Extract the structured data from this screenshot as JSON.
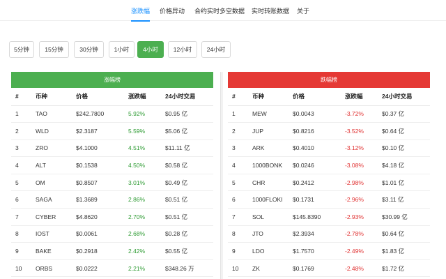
{
  "nav": {
    "tabs": [
      {
        "label": "涨跌幅",
        "active": true
      },
      {
        "label": "价格异动",
        "active": false
      },
      {
        "label": "合约实时多空数据",
        "active": false
      },
      {
        "label": "实时转账数据",
        "active": false
      },
      {
        "label": "关于",
        "active": false
      }
    ]
  },
  "timeframes": [
    {
      "label": "5分钟",
      "active": false
    },
    {
      "label": "15分钟",
      "active": false
    },
    {
      "label": "30分钟",
      "active": false
    },
    {
      "label": "1小时",
      "active": false
    },
    {
      "label": "4小时",
      "active": true
    },
    {
      "label": "12小时",
      "active": false
    },
    {
      "label": "24小时",
      "active": false
    }
  ],
  "colors": {
    "accent": "#1890ff",
    "gain": "#4caf50",
    "loss": "#e53935"
  },
  "gainers": {
    "title": "涨幅榜",
    "columns": [
      "#",
      "币种",
      "价格",
      "涨跌幅",
      "24小时交易"
    ],
    "rows": [
      {
        "rank": "1",
        "symbol": "TAO",
        "price": "$242.7800",
        "change": "5.92%",
        "volume": "$0.95 亿"
      },
      {
        "rank": "2",
        "symbol": "WLD",
        "price": "$2.3187",
        "change": "5.59%",
        "volume": "$5.06 亿"
      },
      {
        "rank": "3",
        "symbol": "ZRO",
        "price": "$4.1000",
        "change": "4.51%",
        "volume": "$11.11 亿"
      },
      {
        "rank": "4",
        "symbol": "ALT",
        "price": "$0.1538",
        "change": "4.50%",
        "volume": "$0.58 亿"
      },
      {
        "rank": "5",
        "symbol": "OM",
        "price": "$0.8507",
        "change": "3.01%",
        "volume": "$0.49 亿"
      },
      {
        "rank": "6",
        "symbol": "SAGA",
        "price": "$1.3689",
        "change": "2.86%",
        "volume": "$0.51 亿"
      },
      {
        "rank": "7",
        "symbol": "CYBER",
        "price": "$4.8620",
        "change": "2.70%",
        "volume": "$0.51 亿"
      },
      {
        "rank": "8",
        "symbol": "IOST",
        "price": "$0.0061",
        "change": "2.68%",
        "volume": "$0.28 亿"
      },
      {
        "rank": "9",
        "symbol": "BAKE",
        "price": "$0.2918",
        "change": "2.42%",
        "volume": "$0.55 亿"
      },
      {
        "rank": "10",
        "symbol": "ORBS",
        "price": "$0.0222",
        "change": "2.21%",
        "volume": "$348.26 万"
      }
    ]
  },
  "losers": {
    "title": "跌幅榜",
    "columns": [
      "#",
      "币种",
      "价格",
      "涨跌幅",
      "24小时交易"
    ],
    "rows": [
      {
        "rank": "1",
        "symbol": "MEW",
        "price": "$0.0043",
        "change": "-3.72%",
        "volume": "$0.37 亿"
      },
      {
        "rank": "2",
        "symbol": "JUP",
        "price": "$0.8216",
        "change": "-3.52%",
        "volume": "$0.64 亿"
      },
      {
        "rank": "3",
        "symbol": "ARK",
        "price": "$0.4010",
        "change": "-3.12%",
        "volume": "$0.10 亿"
      },
      {
        "rank": "4",
        "symbol": "1000BONK",
        "price": "$0.0246",
        "change": "-3.08%",
        "volume": "$4.18 亿"
      },
      {
        "rank": "5",
        "symbol": "CHR",
        "price": "$0.2412",
        "change": "-2.98%",
        "volume": "$1.01 亿"
      },
      {
        "rank": "6",
        "symbol": "1000FLOKI",
        "price": "$0.1731",
        "change": "-2.96%",
        "volume": "$3.11 亿"
      },
      {
        "rank": "7",
        "symbol": "SOL",
        "price": "$145.8390",
        "change": "-2.93%",
        "volume": "$30.99 亿"
      },
      {
        "rank": "8",
        "symbol": "JTO",
        "price": "$2.3934",
        "change": "-2.78%",
        "volume": "$0.64 亿"
      },
      {
        "rank": "9",
        "symbol": "LDO",
        "price": "$1.7570",
        "change": "-2.49%",
        "volume": "$1.83 亿"
      },
      {
        "rank": "10",
        "symbol": "ZK",
        "price": "$0.1769",
        "change": "-2.48%",
        "volume": "$1.72 亿"
      }
    ]
  }
}
